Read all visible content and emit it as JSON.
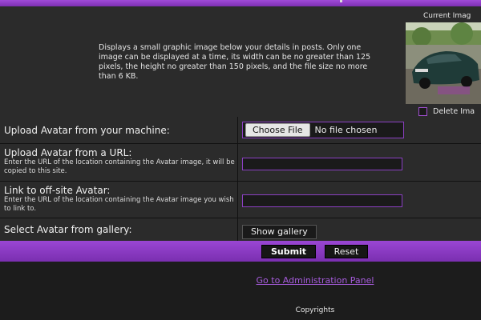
{
  "avatar": {
    "description": "Displays a small graphic image below your details in posts. Only one image can be displayed at a time, its width can be no greater than 125 pixels, the height no greater than 150 pixels, and the file size no more than 6 KB.",
    "current_label": "Current Imag",
    "delete_label": "Delete Ima"
  },
  "rows": {
    "upload_machine": {
      "label": "Upload Avatar from your machine:",
      "button": "Choose File",
      "status": "No file chosen"
    },
    "upload_url": {
      "label": "Upload Avatar from a URL:",
      "hint": "Enter the URL of the location containing the Avatar image, it will be copied to this site.",
      "value": ""
    },
    "offsite": {
      "label": "Link to off-site Avatar:",
      "hint": "Enter the URL of the location containing the Avatar image you wish to link to.",
      "value": ""
    },
    "gallery": {
      "label": "Select Avatar from gallery:",
      "button": "Show gallery"
    }
  },
  "actions": {
    "submit": "Submit",
    "reset": "Reset"
  },
  "footer": {
    "admin_link": "Go to Administration Panel",
    "copyright": "Copyrights"
  },
  "colors": {
    "accent": "#8b3fc2",
    "bar": "#9a46d4",
    "panel": "#2b2b2b",
    "background": "#1c1c1c"
  }
}
